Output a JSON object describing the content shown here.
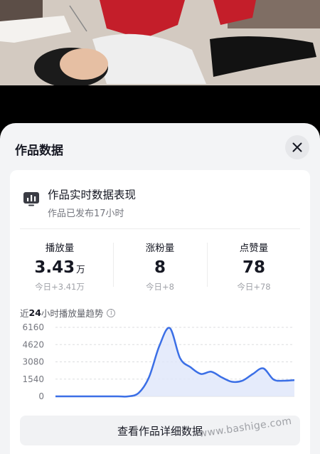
{
  "sheet": {
    "title": "作品数据",
    "close_icon": "close-icon"
  },
  "realtime": {
    "title": "作品实时数据表现",
    "subtitle": "作品已发布17小时",
    "icon": "bar-chart-icon"
  },
  "stats": [
    {
      "label": "播放量",
      "value": "3.43",
      "unit": "万",
      "delta": "今日+3.41万"
    },
    {
      "label": "涨粉量",
      "value": "8",
      "unit": "",
      "delta": "今日+8"
    },
    {
      "label": "点赞量",
      "value": "78",
      "unit": "",
      "delta": "今日+78"
    }
  ],
  "trend": {
    "prefix": "近",
    "hours": "24",
    "suffix": "小时播放量趋势",
    "info_icon": "i"
  },
  "chart_data": {
    "type": "area",
    "title": "",
    "xlabel": "",
    "ylabel": "",
    "ylim": [
      0,
      6160
    ],
    "yticks": [
      "6160",
      "4620",
      "3080",
      "1540",
      "0"
    ],
    "ytick_values": [
      6160,
      4620,
      3080,
      1540,
      0
    ],
    "grid": true,
    "x": [
      1,
      2,
      3,
      4,
      5,
      6,
      7,
      8,
      9,
      10,
      11,
      12,
      13,
      14,
      15,
      16,
      17,
      18,
      19,
      20,
      21,
      22,
      23,
      24
    ],
    "series": [
      {
        "values": [
          0,
          0,
          0,
          0,
          0,
          0,
          0,
          0,
          300,
          1700,
          4500,
          6100,
          3400,
          2600,
          2000,
          2200,
          1700,
          1300,
          1400,
          2000,
          2500,
          1500,
          1400,
          1450
        ]
      }
    ],
    "line_color": "#3b6fe6",
    "fill_color": "#dfe6fa"
  },
  "detail_button": "查看作品详细数据",
  "watermark": "www.bashige.com"
}
